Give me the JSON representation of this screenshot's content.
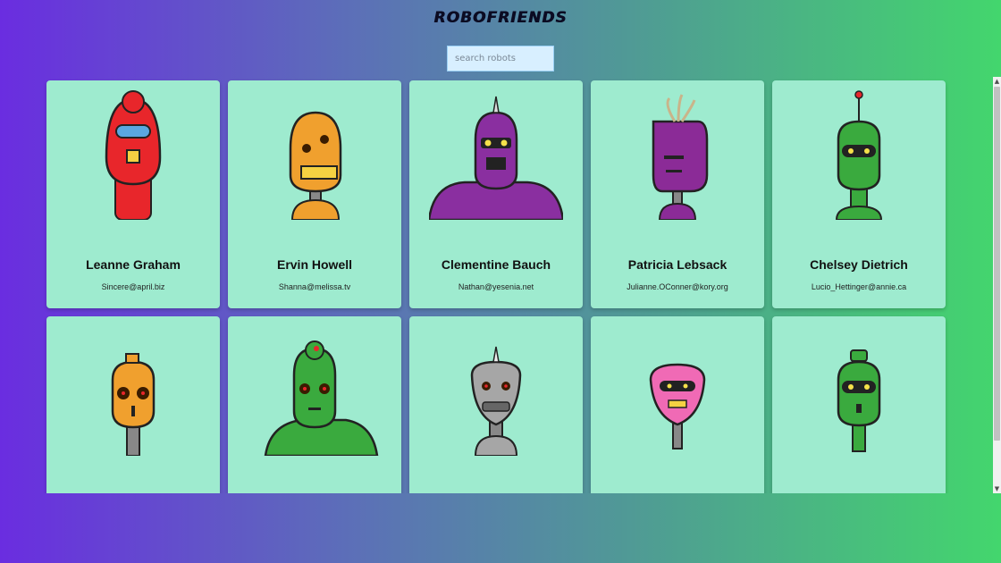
{
  "app": {
    "title": "ROBOFRIENDS"
  },
  "search": {
    "placeholder": "search robots",
    "value": ""
  },
  "robots": [
    {
      "name": "Leanne Graham",
      "email": "Sincere@april.biz",
      "color": "#e8262b"
    },
    {
      "name": "Ervin Howell",
      "email": "Shanna@melissa.tv",
      "color": "#f0a02e"
    },
    {
      "name": "Clementine Bauch",
      "email": "Nathan@yesenia.net",
      "color": "#8a2fa0"
    },
    {
      "name": "Patricia Lebsack",
      "email": "Julianne.OConner@kory.org",
      "color": "#8b2b97"
    },
    {
      "name": "Chelsey Dietrich",
      "email": "Lucio_Hettinger@annie.ca",
      "color": "#3aaa3e"
    },
    {
      "name": "",
      "email": "",
      "color": "#f0a02e"
    },
    {
      "name": "",
      "email": "",
      "color": "#3aaa3e"
    },
    {
      "name": "",
      "email": "",
      "color": "#a6a6a6"
    },
    {
      "name": "",
      "email": "",
      "color": "#f06ab5"
    },
    {
      "name": "",
      "email": "",
      "color": "#3aaa3e"
    }
  ]
}
